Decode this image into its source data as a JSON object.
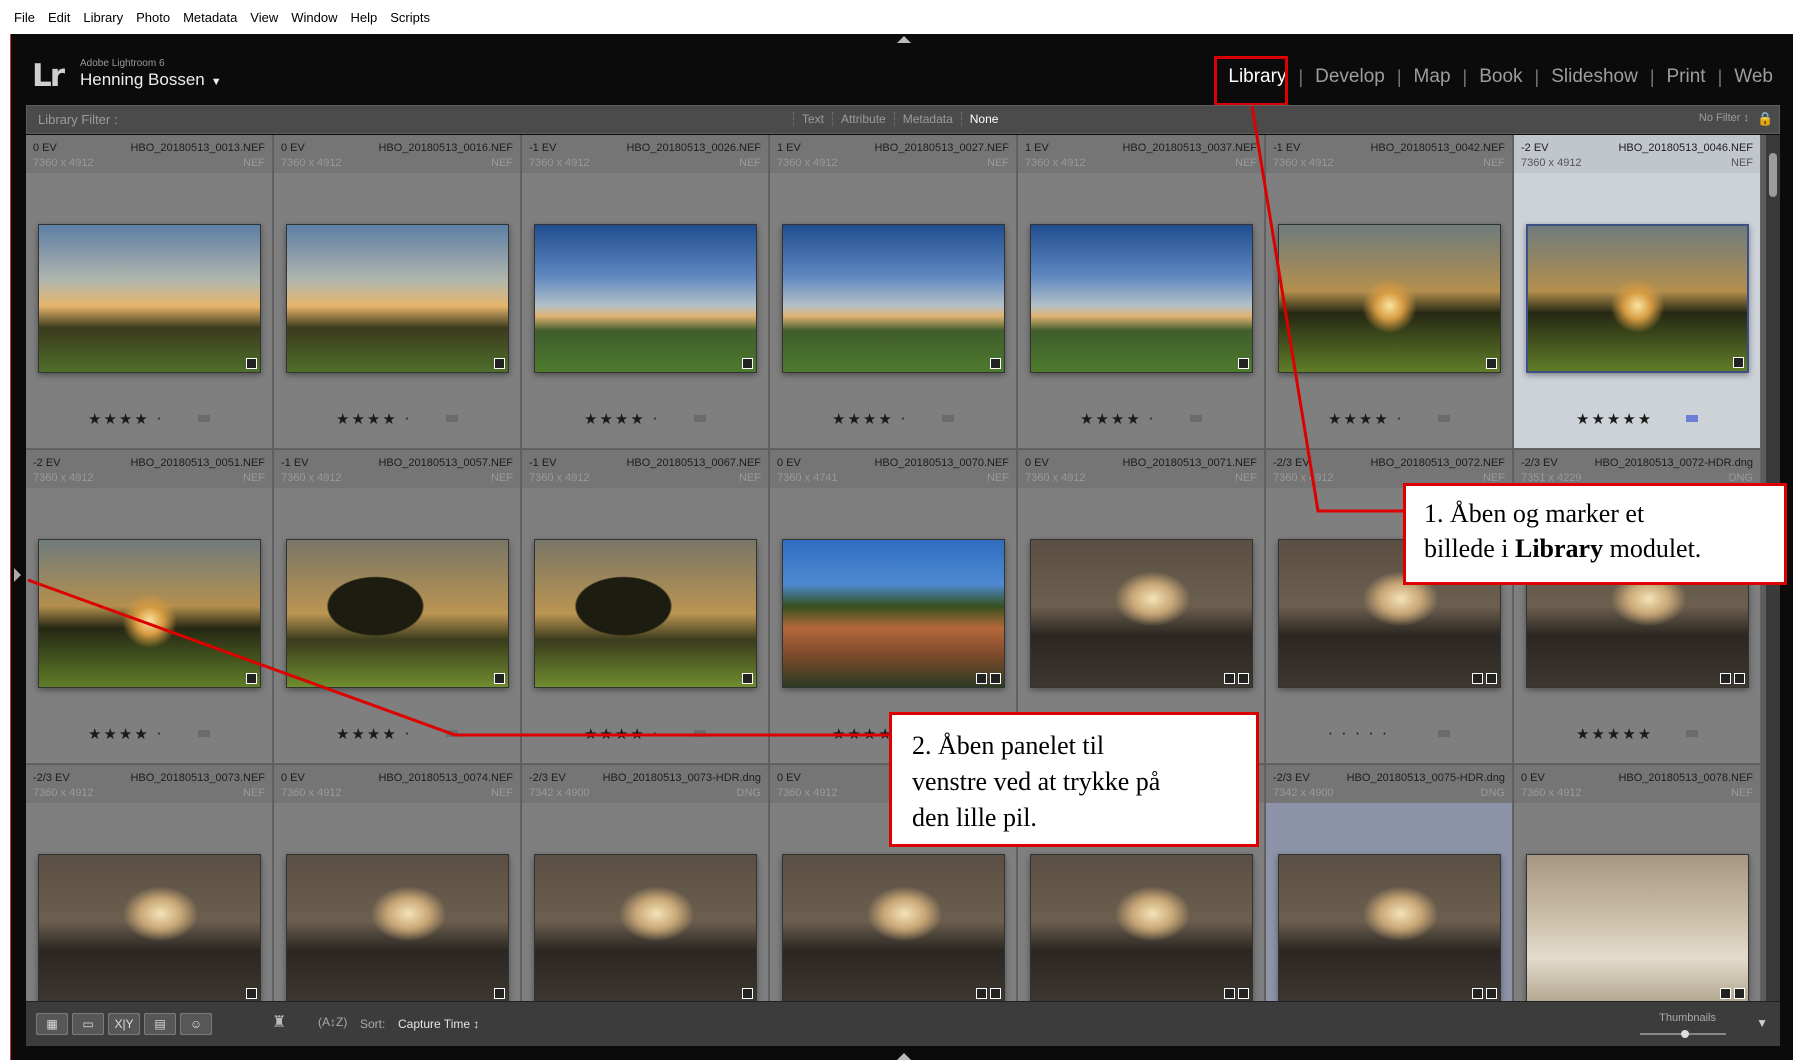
{
  "menubar": {
    "items": [
      "File",
      "Edit",
      "Library",
      "Photo",
      "Metadata",
      "View",
      "Window",
      "Help",
      "Scripts"
    ]
  },
  "identity": {
    "app_name": "Adobe Lightroom 6",
    "user": "Henning Bossen",
    "logo": "Lr"
  },
  "modules": [
    "Library",
    "Develop",
    "Map",
    "Book",
    "Slideshow",
    "Print",
    "Web"
  ],
  "active_module": "Library",
  "filter_bar": {
    "label": "Library Filter :",
    "options": [
      "Text",
      "Attribute",
      "Metadata",
      "None"
    ],
    "selected": "None",
    "preset": "No Filter ↕"
  },
  "grid": {
    "rows": [
      [
        {
          "ev": "0 EV",
          "file": "HBO_20180513_0013.NEF",
          "dims": "7360 x 4912",
          "ext": "NEF",
          "stars": "★★★★ ·",
          "thumb": "sunset-sprinklers"
        },
        {
          "ev": "0 EV",
          "file": "HBO_20180513_0016.NEF",
          "dims": "7360 x 4912",
          "ext": "NEF",
          "stars": "★★★★ ·",
          "thumb": "sunset-sprinklers"
        },
        {
          "ev": "-1 EV",
          "file": "HBO_20180513_0026.NEF",
          "dims": "7360 x 4912",
          "ext": "NEF",
          "stars": "★★★★ ·",
          "thumb": "blue-sky-sprinklers"
        },
        {
          "ev": "1 EV",
          "file": "HBO_20180513_0027.NEF",
          "dims": "7360 x 4912",
          "ext": "NEF",
          "stars": "★★★★ ·",
          "thumb": "blue-sky-sprinklers"
        },
        {
          "ev": "1 EV",
          "file": "HBO_20180513_0037.NEF",
          "dims": "7360 x 4912",
          "ext": "NEF",
          "stars": "★★★★ ·",
          "thumb": "blue-sky-sprinklers"
        },
        {
          "ev": "-1 EV",
          "file": "HBO_20180513_0042.NEF",
          "dims": "7360 x 4912",
          "ext": "NEF",
          "stars": "★★★★ ·",
          "thumb": "tree-sunset"
        },
        {
          "ev": "-2 EV",
          "file": "HBO_20180513_0046.NEF",
          "dims": "7360 x 4912",
          "ext": "NEF",
          "stars": "★★★★★",
          "thumb": "tree-sunset",
          "selected": true
        }
      ],
      [
        {
          "ev": "-2 EV",
          "file": "HBO_20180513_0051.NEF",
          "dims": "7360 x 4912",
          "ext": "NEF",
          "stars": "★★★★ ·",
          "thumb": "tree-sunset"
        },
        {
          "ev": "-1 EV",
          "file": "HBO_20180513_0057.NEF",
          "dims": "7360 x 4912",
          "ext": "NEF",
          "stars": "★★★★ ·",
          "thumb": "tree-shadow"
        },
        {
          "ev": "-1 EV",
          "file": "HBO_20180513_0067.NEF",
          "dims": "7360 x 4912",
          "ext": "NEF",
          "stars": "★★★★ ·",
          "thumb": "tree-shadow"
        },
        {
          "ev": "0 EV",
          "file": "HBO_20180513_0070.NEF",
          "dims": "7360 x 4741",
          "ext": "NEF",
          "stars": "★★★★ ·",
          "thumb": "house-garden"
        },
        {
          "ev": "0 EV",
          "file": "HBO_20180513_0071.NEF",
          "dims": "7360 x 4912",
          "ext": "NEF",
          "stars": "★★★★ ·",
          "thumb": "hotel-room"
        },
        {
          "ev": "-2/3 EV",
          "file": "HBO_20180513_0072.NEF",
          "dims": "7360 x 4912",
          "ext": "NEF",
          "stars": "· · · · ·",
          "thumb": "hotel-room"
        },
        {
          "ev": "-2/3 EV",
          "file": "HBO_20180513_0072-HDR.dng",
          "dims": "7351 x 4229",
          "ext": "DNG",
          "stars": "★★★★★",
          "thumb": "hotel-room"
        }
      ],
      [
        {
          "ev": "-2/3 EV",
          "file": "HBO_20180513_0073.NEF",
          "dims": "7360 x 4912",
          "ext": "NEF",
          "stars": "",
          "thumb": "hotel-room"
        },
        {
          "ev": "0 EV",
          "file": "HBO_20180513_0074.NEF",
          "dims": "7360 x 4912",
          "ext": "NEF",
          "stars": "",
          "thumb": "hotel-room"
        },
        {
          "ev": "-2/3 EV",
          "file": "HBO_20180513_0073-HDR.dng",
          "dims": "7342 x 4900",
          "ext": "DNG",
          "stars": "",
          "thumb": "hotel-room"
        },
        {
          "ev": "0 EV",
          "file": "HB",
          "dims": "7360 x 4912",
          "ext": "",
          "stars": "",
          "thumb": "hotel-room"
        },
        {
          "ev": "",
          "file": "",
          "dims": "",
          "ext": "",
          "stars": "",
          "thumb": "hotel-room"
        },
        {
          "ev": "-2/3 EV",
          "file": "HBO_20180513_0075-HDR.dng",
          "dims": "7342 x 4900",
          "ext": "DNG",
          "stars": "",
          "thumb": "hotel-room",
          "highlight": true
        },
        {
          "ev": "0 EV",
          "file": "HBO_20180513_0078.NEF",
          "dims": "7360 x 4912",
          "ext": "NEF",
          "stars": "",
          "thumb": "bathroom"
        }
      ]
    ]
  },
  "toolbar": {
    "sort_label": "Sort:",
    "sort_value": "Capture Time ↕",
    "thumbnails_label": "Thumbnails",
    "view_buttons": [
      "grid",
      "loupe",
      "compare",
      "survey",
      "people"
    ],
    "compare_label": "X|Y"
  },
  "annotations": {
    "step1": {
      "line1": "1. Åben og marker et",
      "line2_pre": "billede i ",
      "line2_bold": "Library",
      "line2_post": " modulet."
    },
    "step2": {
      "line1": "2. Åben panelet til",
      "line2": "venstre ved at trykke på",
      "line3": "den lille pil."
    }
  },
  "colors": {
    "annotation_red": "#dd0000",
    "selected_cell": "#cdd2d9",
    "panel_bg": "#0b0b0b"
  }
}
